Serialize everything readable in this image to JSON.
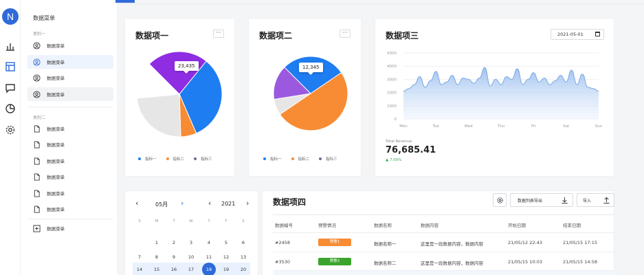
{
  "rail": {
    "logo": "N"
  },
  "menu": {
    "title": "数据菜单",
    "group1": "类别一",
    "group1_items": [
      "数据菜单",
      "数据菜单",
      "数据菜单",
      "数据菜单"
    ],
    "group2": "类别二",
    "group2_items": [
      "数据菜单",
      "数据菜单",
      "数据菜单",
      "数据菜单",
      "数据菜单",
      "数据菜单"
    ],
    "add_item": "数据菜单"
  },
  "card1": {
    "title": "数据项一",
    "more": "···",
    "tooltip": "23,435",
    "legend": [
      "指标一",
      "指标二",
      "指标三"
    ]
  },
  "card2": {
    "title": "数据项二",
    "more": "···",
    "tooltip": "12,345",
    "legend": [
      "指标一",
      "指标二",
      "指标三"
    ]
  },
  "card3": {
    "title": "数据项三",
    "date": "2021-05-01",
    "revenue_label": "Total Revenue",
    "revenue_value": "76,685.41",
    "revenue_change": "▲ 7.00%"
  },
  "chart_data": [
    {
      "type": "pie",
      "labels": [
        "指标一",
        "指标二",
        "指标三",
        "",
        ""
      ],
      "values": [
        23.4,
        32.6,
        6.0,
        24.0,
        14.0
      ],
      "colors": [
        "#8e2de2",
        "#1e7df0",
        "#f78c35",
        "#e6e6e6",
        "#ffffff"
      ],
      "legend": [
        "指标一",
        "指标二",
        "指标三"
      ]
    },
    {
      "type": "pie",
      "labels": [
        "",
        "",
        "",
        ""
      ],
      "values": [
        28,
        50,
        7,
        15
      ],
      "colors": [
        "#1e7df0",
        "#f78c35",
        "#e6e6e6",
        "#9b59e0"
      ],
      "legend": [
        "指标一",
        "指标二",
        "指标三"
      ]
    },
    {
      "type": "area",
      "x": [
        "Mon",
        "Tue",
        "Wed",
        "Thu",
        "Fri",
        "Sat",
        "Sun"
      ],
      "ylim": [
        0,
        5000
      ],
      "yticks": [
        "5000",
        "4000",
        "3000",
        "2000",
        "1000",
        "0"
      ],
      "values": [
        2100,
        2300,
        2600,
        3200,
        2400,
        2900,
        3600,
        2600,
        2800,
        3300,
        2600,
        3100,
        3000,
        2700,
        3100,
        3900,
        2500,
        3000,
        2600,
        3200,
        3000,
        3800,
        2600,
        3000,
        3500,
        2800,
        3100,
        2600,
        2900,
        3300,
        2800,
        3700,
        2600,
        3400,
        2400,
        2300,
        2100
      ]
    }
  ],
  "calendar": {
    "month": "05月",
    "year": "2021",
    "weekdays": [
      "S",
      "M",
      "T",
      "W",
      "T",
      "F",
      "S"
    ],
    "rows": [
      [
        "",
        "1",
        "2",
        "3",
        "4",
        "5",
        "6"
      ],
      [
        "7",
        "8",
        "9",
        "10",
        "11",
        "12",
        "13"
      ],
      [
        "14",
        "15",
        "16",
        "17",
        "18",
        "19",
        "20"
      ]
    ]
  },
  "table": {
    "title": "数据项四",
    "export_label": "数据列表导出",
    "import_label": "导入",
    "headers": [
      "数据编号",
      "预警情况",
      "数据名称",
      "数据内容",
      "开始日期",
      "结束日期"
    ],
    "rows": [
      {
        "id": "#2458",
        "alert": "预警1",
        "alert_color": "#f78c35",
        "name": "数据名称一",
        "content": "这里是一段数据内容，数据内容",
        "start": "21/05/12 22:43",
        "end": "21/05/15 17:15"
      },
      {
        "id": "#3530",
        "alert": "预警2",
        "alert_color": "#3aa42c",
        "name": "数据名称二",
        "content": "这里是一段数据内容，数据内容",
        "start": "21/05/15 10:03",
        "end": "21/05/15 14:58"
      }
    ]
  }
}
